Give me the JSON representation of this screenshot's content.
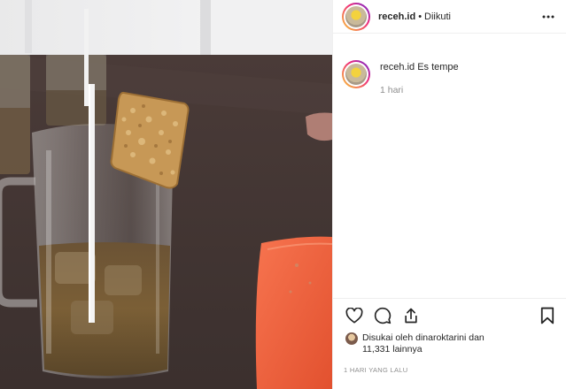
{
  "header": {
    "username": "receh.id",
    "separator": "•",
    "follow_state": "Diikuti",
    "more_icon": "more-horizontal-icon"
  },
  "caption": {
    "username": "receh.id",
    "text": "Es tempe",
    "time": "1 hari"
  },
  "actions": {
    "icons": [
      "heart-icon",
      "comment-icon",
      "share-icon",
      "bookmark-icon"
    ]
  },
  "likes": {
    "prefix": "Disukai oleh",
    "user": "dinaroktarini",
    "conjunction": "dan",
    "count_text": "11,331 lainnya"
  },
  "post_date": "1 HARI YANG LALU",
  "colors": {
    "border": "#efefef",
    "text": "#262626",
    "muted": "#8e8e8e",
    "plate": "#f2603f"
  }
}
